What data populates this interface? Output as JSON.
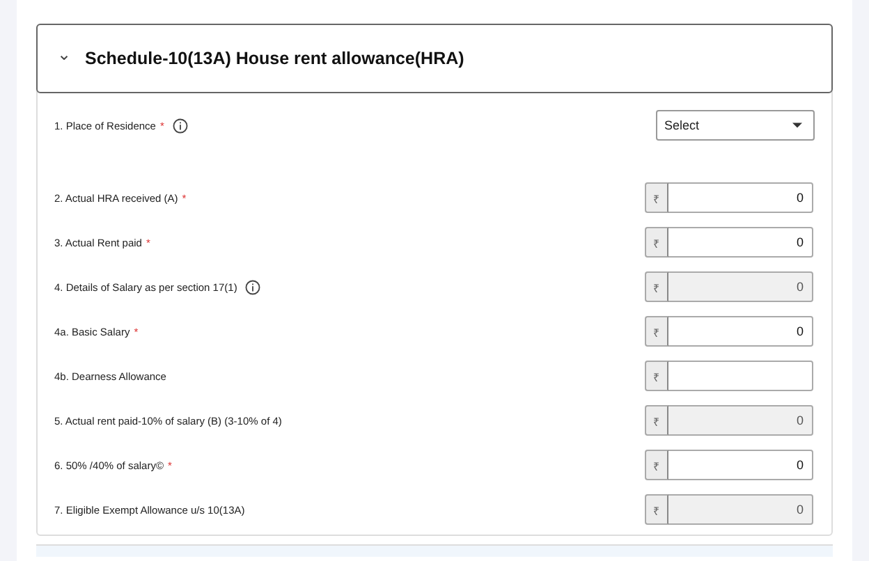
{
  "section": {
    "title": "Schedule-10(13A) House rent allowance(HRA)",
    "expanded": true,
    "toggle_icon": "⌄"
  },
  "fields": [
    {
      "kind": "select",
      "label": "1. Place of Residence",
      "required": true,
      "info": true,
      "value": "Select"
    },
    {
      "kind": "amount",
      "label": "2. Actual HRA received (A)",
      "required": true,
      "info": false,
      "currency": "₹",
      "value": "0",
      "disabled": false
    },
    {
      "kind": "amount",
      "label": "3. Actual Rent paid",
      "required": true,
      "info": false,
      "currency": "₹",
      "value": "0",
      "disabled": false
    },
    {
      "kind": "amount",
      "label": "4. Details of Salary as per section 17(1)",
      "required": false,
      "info": true,
      "currency": "₹",
      "value": "0",
      "disabled": true
    },
    {
      "kind": "amount",
      "label": "4a. Basic Salary",
      "required": true,
      "info": false,
      "currency": "₹",
      "value": "0",
      "disabled": false
    },
    {
      "kind": "amount",
      "label": "4b. Dearness Allowance",
      "required": false,
      "info": false,
      "currency": "₹",
      "disabled": false
    },
    {
      "kind": "amount",
      "label": "5. Actual rent paid-10% of salary (B) (3-10% of 4)",
      "required": false,
      "info": false,
      "currency": "₹",
      "value": "0",
      "disabled": true
    },
    {
      "kind": "amount",
      "label": "6. 50% /40% of salary©",
      "required": true,
      "info": false,
      "currency": "₹",
      "value": "0",
      "disabled": false
    },
    {
      "kind": "amount",
      "label": "7. Eligible Exempt Allowance u/s 10(13A)",
      "required": false,
      "info": false,
      "currency": "₹",
      "value": "0",
      "disabled": true
    }
  ],
  "required_mark": "*"
}
